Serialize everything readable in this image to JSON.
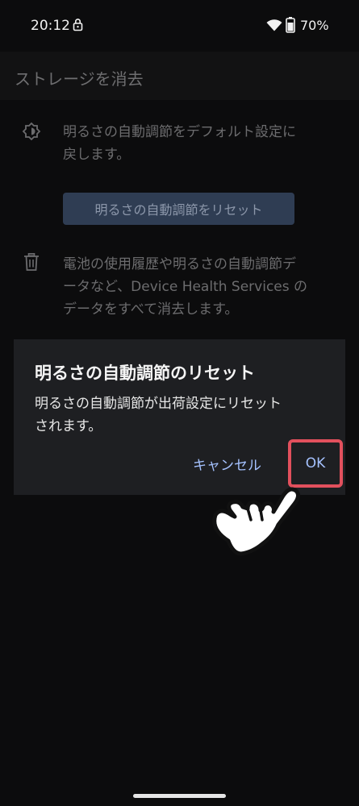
{
  "status_bar": {
    "time": "20:12",
    "battery": "70%",
    "icons": [
      "lock-icon",
      "wifi-icon",
      "battery-icon"
    ]
  },
  "app_bar": {
    "title": "ストレージを消去"
  },
  "brightness_section": {
    "icon": "brightness-auto-icon",
    "description_lines": [
      "明るさの自動調節をデフォルト設定に",
      "戻します。"
    ],
    "reset_button_label": "明るさの自動調節をリセット"
  },
  "delete_section": {
    "icon": "trash-icon",
    "description_lines": [
      "電池の使用履歴や明るさの自動調節デ",
      "ータなど、Device Health Services の",
      "データをすべて消去します。"
    ]
  },
  "dialog": {
    "title": "明るさの自動調節のリセット",
    "body_lines": [
      "明るさの自動調節が出荷設定にリセット",
      "されます。"
    ],
    "cancel_label": "キャンセル",
    "ok_label": "OK",
    "ok_highlight_color": "#e2505d",
    "accent_color": "#a5c2ff"
  },
  "overlay": {
    "pointer": "hand-pointer-icon"
  }
}
